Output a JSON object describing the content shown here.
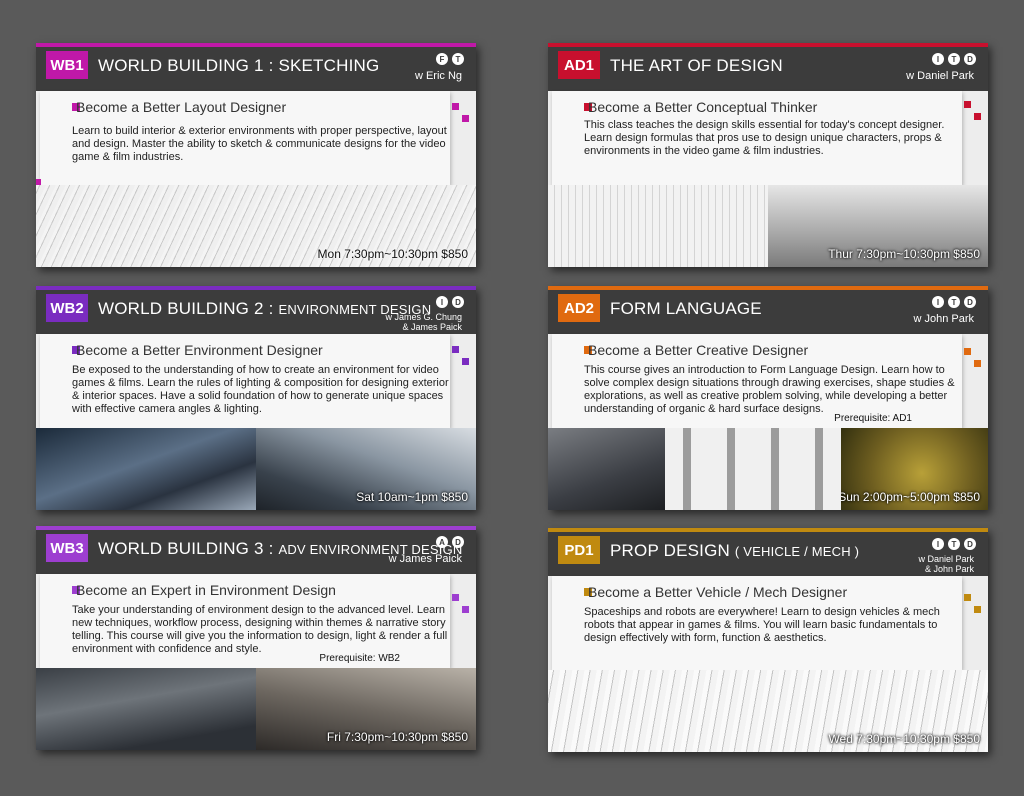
{
  "colors": {
    "wb1": "#c018a8",
    "wb2": "#7a2cc0",
    "wb3": "#9d3ed0",
    "ad1": "#c8102e",
    "ad2": "#e06a10",
    "pd1": "#c08a10"
  },
  "icons": {
    "badge_shape": "circle-letter-icon",
    "bullet_shape": "square-bullet-icon"
  },
  "courses": {
    "wb1": {
      "code": "WB1",
      "title": "WORLD BUILDING 1 : SKETCHING",
      "title_sub": "",
      "badges": [
        "F",
        "T"
      ],
      "instructor_lines": [
        "w Eric Ng"
      ],
      "tagline": "Become a Better Layout Designer",
      "description": "Learn to build interior & exterior environments with proper perspective, layout and design.  Master the ability to sketch & communicate designs for the video game & film industries.",
      "prerequisite": "",
      "schedule": "Mon 7:30pm~10:30pm    $850"
    },
    "wb2": {
      "code": "WB2",
      "title": "WORLD BUILDING 2 : ",
      "title_sub": "ENVIRONMENT DESIGN",
      "badges": [
        "I",
        "D"
      ],
      "instructor_lines": [
        "w James G. Chung",
        "& James Paick"
      ],
      "tagline": "Become a Better Environment Designer",
      "description": "Be exposed to the understanding of how to create an environment for video games & films. Learn the rules of lighting & composition for designing exterior & interior spaces. Have a solid foundation of how to generate unique spaces with effective camera angles & lighting.",
      "prerequisite": "",
      "schedule": "Sat 10am~1pm    $850"
    },
    "wb3": {
      "code": "WB3",
      "title": "WORLD BUILDING 3 : ",
      "title_sub": "ADV ENVIRONMENT DESIGN",
      "badges": [
        "A",
        "D"
      ],
      "instructor_lines": [
        "w James Paick"
      ],
      "tagline": "Become an Expert in Environment Design",
      "description": "Take your understanding of environment design to the advanced level. Learn new techniques, workflow process, designing within themes & narrative story telling. This course will give you the information to design, light & render a full environment with confidence and style.",
      "prerequisite": "Prerequisite: WB2",
      "schedule": "Fri 7:30pm~10:30pm    $850"
    },
    "ad1": {
      "code": "AD1",
      "title": "THE ART OF DESIGN",
      "title_sub": "",
      "badges": [
        "I",
        "T",
        "D"
      ],
      "instructor_lines": [
        "w Daniel Park"
      ],
      "tagline": "Become a Better Conceptual Thinker",
      "description": "This class teaches the design skills essential for today's concept designer. Learn design formulas that pros use to design unique  characters, props & environments in the video game & film industries.",
      "prerequisite": "",
      "schedule": "Thur 7:30pm~10:30pm    $850"
    },
    "ad2": {
      "code": "AD2",
      "title": "FORM LANGUAGE",
      "title_sub": "",
      "badges": [
        "I",
        "T",
        "D"
      ],
      "instructor_lines": [
        "w John Park"
      ],
      "tagline": "Become a Better Creative Designer",
      "description": "This course gives an introduction to Form Language Design. Learn how to solve complex design situations through drawing exercises, shape studies & explorations, as well as creative problem solving, while developing a better understanding of organic & hard surface designs.",
      "prerequisite": "Prerequisite: AD1",
      "schedule": "Sun 2:00pm~5:00pm    $850"
    },
    "pd1": {
      "code": "PD1",
      "title": "PROP DESIGN ",
      "title_sub": "( VEHICLE / MECH )",
      "badges": [
        "I",
        "T",
        "D"
      ],
      "instructor_lines": [
        "w Daniel Park",
        "& John Park"
      ],
      "tagline": "Become a Better Vehicle / Mech Designer",
      "description": "Spaceships and robots are everywhere!  Learn to design vehicles & mech robots that appear in games & films. You will learn basic fundamentals to design effectively with form, function & aesthetics.",
      "prerequisite": "",
      "schedule": "Wed 7:30pm~10:30pm    $850"
    }
  }
}
